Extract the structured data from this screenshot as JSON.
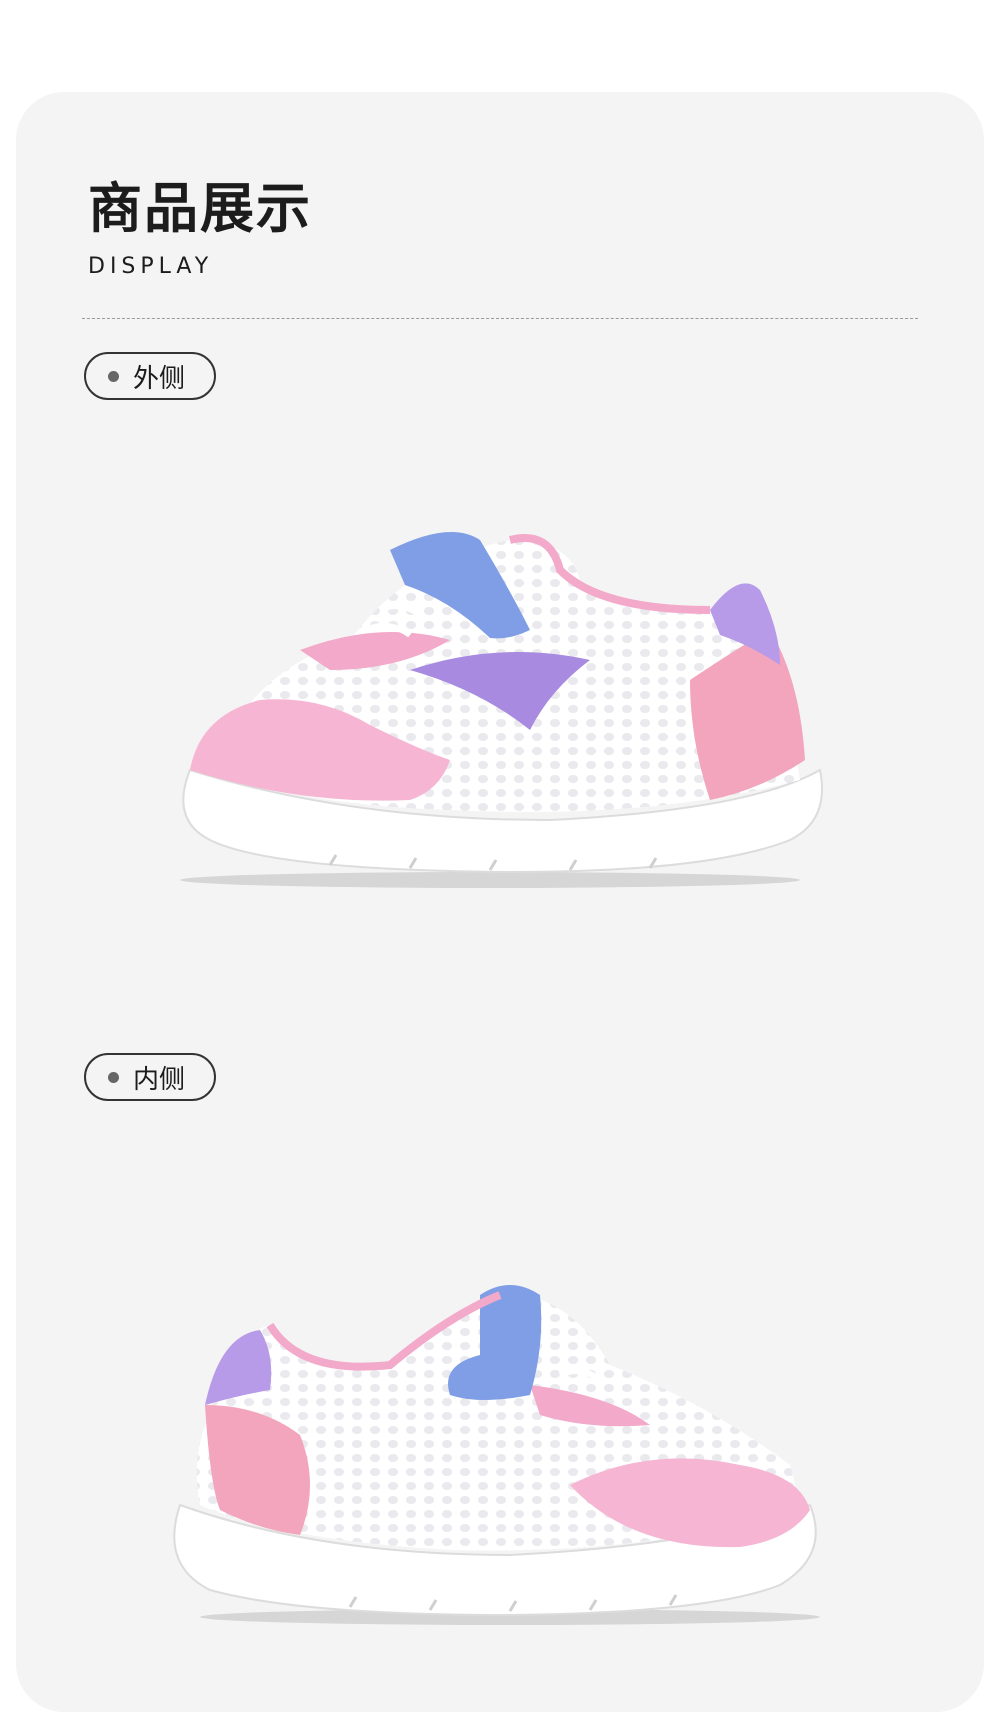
{
  "section": {
    "title": "商品展示",
    "subtitle": "DISPLAY"
  },
  "views": [
    {
      "label": "外侧",
      "icon": "bullet-dot-icon",
      "image": "shoe-outer-side-image"
    },
    {
      "label": "内侧",
      "icon": "bullet-dot-icon",
      "image": "shoe-inner-side-image"
    }
  ],
  "colors": {
    "background": "#f4f4f4",
    "pink": "#f3a9c9",
    "blue_strap": "#7f9ee6",
    "purple": "#a88ae0",
    "mesh": "#ffffff"
  }
}
